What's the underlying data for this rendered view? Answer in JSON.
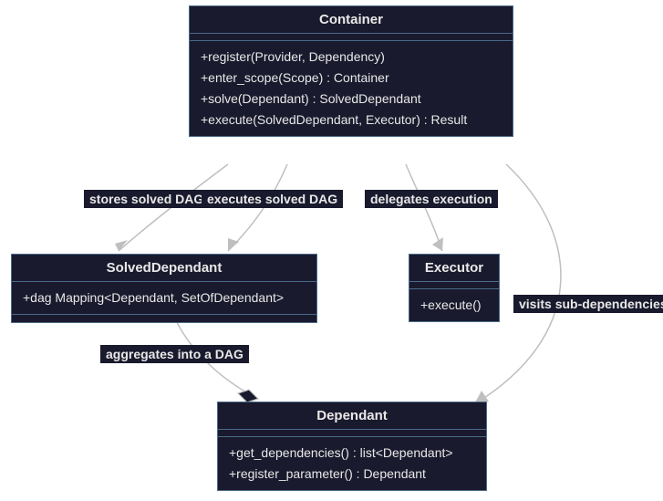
{
  "classes": {
    "container": {
      "name": "Container",
      "methods": [
        "+register(Provider, Dependency)",
        "+enter_scope(Scope) : Container",
        "+solve(Dependant) : SolvedDependant",
        "+execute(SolvedDependant, Executor) : Result"
      ]
    },
    "solvedDependant": {
      "name": "SolvedDependant",
      "attrs": [
        "+dag Mapping<Dependant, SetOfDependant>"
      ]
    },
    "executor": {
      "name": "Executor",
      "methods": [
        "+execute()"
      ]
    },
    "dependant": {
      "name": "Dependant",
      "methods": [
        "+get_dependencies() : list<Dependant>",
        "+register_parameter() : Dependant"
      ]
    }
  },
  "edges": {
    "storesSolvedDag": "stores solved DAG",
    "executesSolvedDag": "executes solved DAG",
    "delegatesExecution": "delegates execution",
    "visitsSubDeps": "visits sub-dependencies",
    "aggregatesDag": "aggregates into a DAG"
  }
}
